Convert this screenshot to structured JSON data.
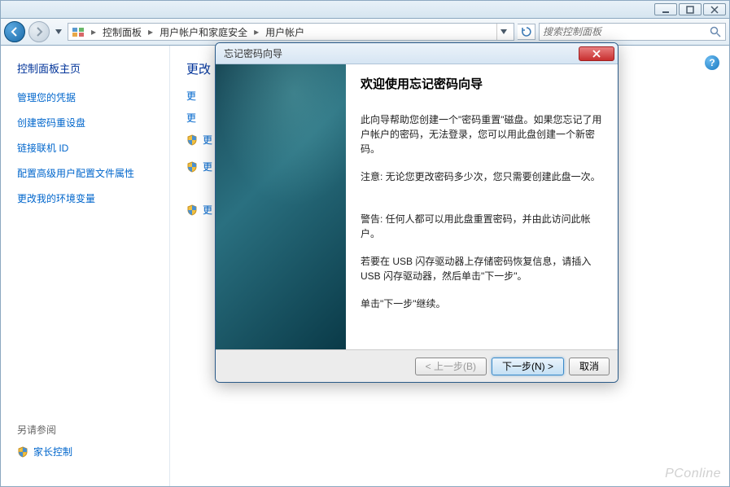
{
  "window_controls": {
    "min": "min",
    "max": "max",
    "close": "close"
  },
  "breadcrumb": {
    "root": "控制面板",
    "seg1": "用户帐户和家庭安全",
    "seg2": "用户帐户"
  },
  "search": {
    "placeholder": "搜索控制面板"
  },
  "sidebar": {
    "main": "控制面板主页",
    "links": [
      "管理您的凭据",
      "创建密码重设盘",
      "链接联机 ID",
      "配置高级用户配置文件属性",
      "更改我的环境变量"
    ],
    "seealso_label": "另请参阅",
    "seealso_link": "家长控制"
  },
  "main": {
    "heading": "更改",
    "partial_tasks": [
      "更",
      "更",
      "更",
      "更",
      "更"
    ]
  },
  "wizard": {
    "title": "忘记密码向导",
    "heading": "欢迎使用忘记密码向导",
    "p1": "此向导帮助您创建一个\"密码重置\"磁盘。如果您忘记了用户帐户的密码，无法登录，您可以用此盘创建一个新密码。",
    "p2": "注意:  无论您更改密码多少次，您只需要创建此盘一次。",
    "p3": "警告:  任何人都可以用此盘重置密码，并由此访问此帐户。",
    "p4": "若要在 USB 闪存驱动器上存储密码恢复信息，请插入 USB 闪存驱动器，然后单击\"下一步\"。",
    "p5": "单击\"下一步\"继续。",
    "back_btn": "< 上一步(B)",
    "next_btn": "下一步(N) >",
    "cancel_btn": "取消"
  },
  "watermark": "PConline"
}
